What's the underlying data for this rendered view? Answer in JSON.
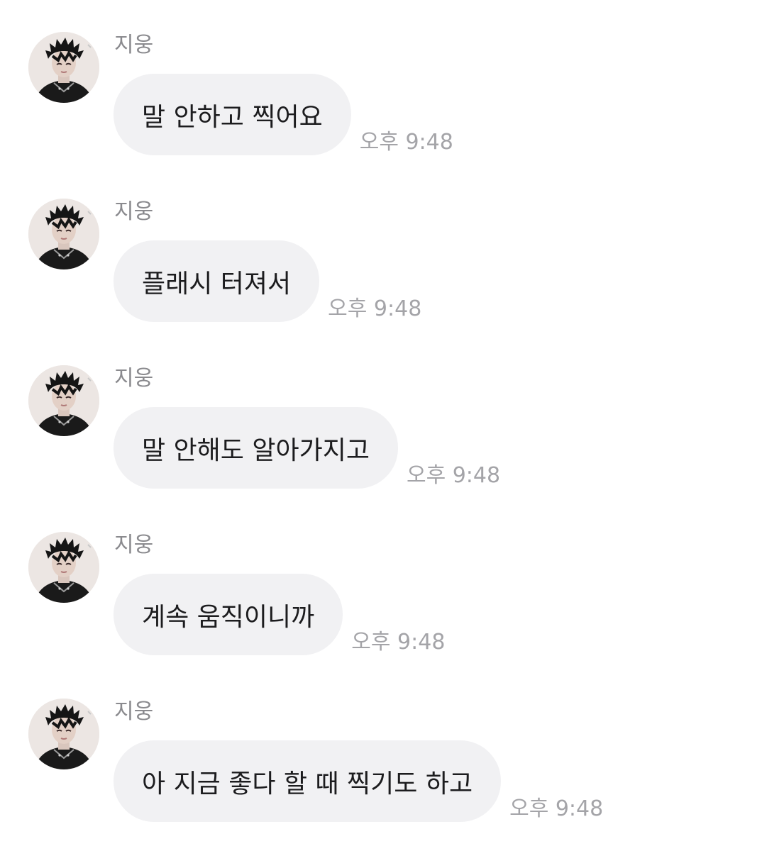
{
  "chat": {
    "messages": [
      {
        "sender": "지웅",
        "text": "말 안하고 찍어요",
        "time": "오후 9:48"
      },
      {
        "sender": "지웅",
        "text": "플래시 터져서",
        "time": "오후 9:48"
      },
      {
        "sender": "지웅",
        "text": "말 안해도 알아가지고",
        "time": "오후 9:48"
      },
      {
        "sender": "지웅",
        "text": "계속 움직이니까",
        "time": "오후 9:48"
      },
      {
        "sender": "지웅",
        "text": "아 지금 좋다 할 때 찍기도 하고",
        "time": "오후 9:48"
      }
    ]
  },
  "colors": {
    "bubble_background": "#f1f1f3",
    "message_text": "#1c1c1e",
    "sender_text": "#8a8a8e",
    "time_text": "#a4a4a8"
  },
  "icons": {
    "avatar": "profile-photo-icon"
  }
}
